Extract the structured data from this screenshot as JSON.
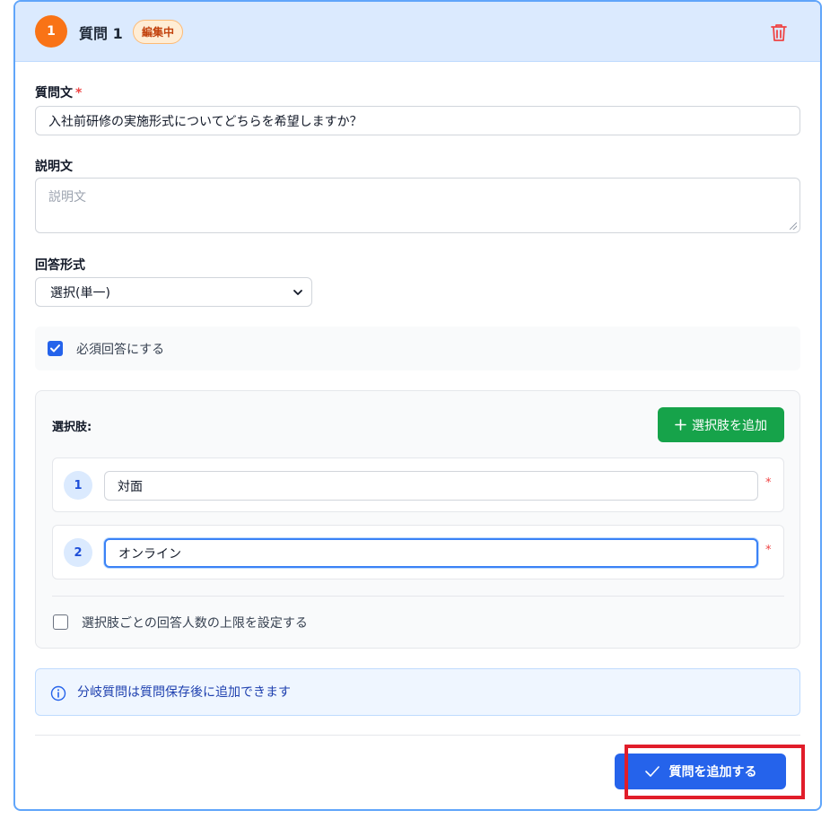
{
  "question": {
    "number": "1",
    "title": "質問 1",
    "status_badge": "編集中"
  },
  "question_text": {
    "label": "質問文",
    "required_mark": "*",
    "value": "入社前研修の実施形式についてどちらを希望しますか？"
  },
  "description": {
    "label": "説明文",
    "placeholder": "説明文"
  },
  "answer_type": {
    "label": "回答形式",
    "selected": "選択(単一)"
  },
  "required_toggle": {
    "label": "必須回答にする",
    "checked": true
  },
  "options": {
    "label": "選択肢:",
    "add_button": "選択肢を追加",
    "items": [
      {
        "number": "1",
        "value": "対面",
        "required_mark": "*"
      },
      {
        "number": "2",
        "value": "オンライン",
        "required_mark": "*"
      }
    ],
    "limit_label": "選択肢ごとの回答人数の上限を設定する"
  },
  "info": {
    "message": "分岐質問は質問保存後に追加できます"
  },
  "submit": {
    "label": "質問を追加する"
  },
  "colors": {
    "accent": "#2563eb",
    "badge_orange": "#f97316",
    "add_green": "#16a34a",
    "danger": "#ef4444",
    "highlight": "#e11d2a"
  },
  "icons": {
    "delete": "trash-icon",
    "add": "plus-icon",
    "info": "info-icon",
    "submit": "check-icon",
    "dropdown": "chevron-down-icon"
  }
}
